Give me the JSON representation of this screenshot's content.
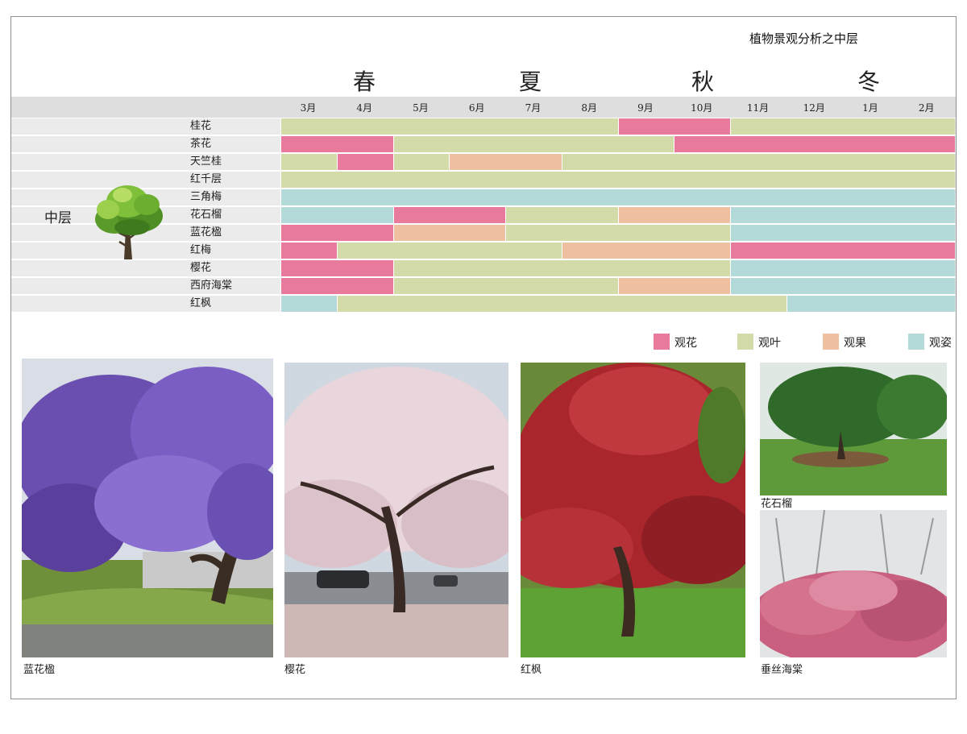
{
  "page_title": "植物景观分析之中层",
  "layer_label": "中层",
  "seasons": [
    "春",
    "夏",
    "秋",
    "冬"
  ],
  "chart_data": {
    "type": "table",
    "title": "植物景观分析之中层",
    "months": [
      "3月",
      "4月",
      "5月",
      "6月",
      "7月",
      "8月",
      "9月",
      "10月",
      "11月",
      "12月",
      "1月",
      "2月"
    ],
    "categories": {
      "flower": {
        "label": "观花",
        "color": "#e87a9b"
      },
      "leaf": {
        "label": "观叶",
        "color": "#d3dba9"
      },
      "fruit": {
        "label": "观果",
        "color": "#efc0a0"
      },
      "form": {
        "label": "观姿",
        "color": "#b3d9d8"
      }
    },
    "plants": [
      {
        "name": "桂花",
        "segments": [
          [
            "leaf",
            0,
            6
          ],
          [
            "flower",
            6,
            8
          ],
          [
            "leaf",
            8,
            12
          ]
        ]
      },
      {
        "name": "茶花",
        "segments": [
          [
            "flower",
            0,
            2
          ],
          [
            "leaf",
            2,
            7
          ],
          [
            "flower",
            7,
            12
          ]
        ]
      },
      {
        "name": "天竺桂",
        "segments": [
          [
            "leaf",
            0,
            1
          ],
          [
            "flower",
            1,
            2
          ],
          [
            "leaf",
            2,
            3
          ],
          [
            "fruit",
            3,
            5
          ],
          [
            "leaf",
            5,
            12
          ]
        ]
      },
      {
        "name": "红千层",
        "segments": [
          [
            "leaf",
            0,
            12
          ]
        ]
      },
      {
        "name": "三角梅",
        "segments": [
          [
            "form",
            0,
            12
          ]
        ]
      },
      {
        "name": "花石榴",
        "segments": [
          [
            "form",
            0,
            2
          ],
          [
            "flower",
            2,
            4
          ],
          [
            "leaf",
            4,
            6
          ],
          [
            "fruit",
            6,
            8
          ],
          [
            "form",
            8,
            12
          ]
        ]
      },
      {
        "name": "蓝花楹",
        "segments": [
          [
            "flower",
            0,
            2
          ],
          [
            "fruit",
            2,
            4
          ],
          [
            "leaf",
            4,
            8
          ],
          [
            "form",
            8,
            12
          ]
        ]
      },
      {
        "name": "红梅",
        "segments": [
          [
            "flower",
            0,
            1
          ],
          [
            "leaf",
            1,
            5
          ],
          [
            "fruit",
            5,
            8
          ],
          [
            "flower",
            8,
            12
          ]
        ]
      },
      {
        "name": "樱花",
        "segments": [
          [
            "flower",
            0,
            2
          ],
          [
            "leaf",
            2,
            8
          ],
          [
            "form",
            8,
            12
          ]
        ]
      },
      {
        "name": "西府海棠",
        "segments": [
          [
            "flower",
            0,
            2
          ],
          [
            "leaf",
            2,
            6
          ],
          [
            "fruit",
            6,
            8
          ],
          [
            "form",
            8,
            12
          ]
        ]
      },
      {
        "name": "红枫",
        "segments": [
          [
            "form",
            0,
            1
          ],
          [
            "leaf",
            1,
            9
          ],
          [
            "form",
            9,
            12
          ]
        ]
      }
    ]
  },
  "photos": [
    {
      "caption": "蓝花楹"
    },
    {
      "caption": "樱花"
    },
    {
      "caption": "红枫"
    },
    {
      "caption": "花石榴"
    },
    {
      "caption": "垂丝海棠"
    }
  ]
}
